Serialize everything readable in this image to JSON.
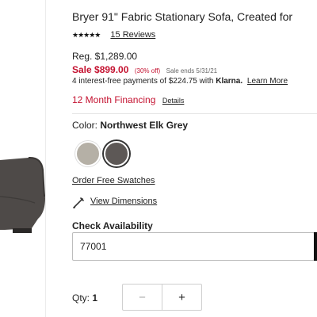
{
  "product": {
    "title": "Bryer 91\" Fabric Stationary Sofa, Created for",
    "stars": "★★★★★",
    "reviews_link": "15 Reviews"
  },
  "pricing": {
    "regular": "Reg. $1,289.00",
    "sale": "Sale $899.00",
    "discount": "(30% off)",
    "sale_end": "Sale ends 5/31/21",
    "installments_text": "4 interest-free payments of $224.75 with",
    "installments_brand": "Klarna.",
    "learn_more": "Learn More",
    "financing": "12 Month Financing",
    "financing_details": "Details"
  },
  "color": {
    "label": "Color: ",
    "value": "Northwest Elk Grey",
    "swatches": [
      {
        "name": "Light Grey",
        "hex": "#b5b0a6"
      },
      {
        "name": "Northwest Elk Grey",
        "hex": "#5d5856",
        "selected": true
      }
    ]
  },
  "links": {
    "order_swatches": "Order Free Swatches",
    "view_dimensions": "View Dimensions"
  },
  "availability": {
    "label": "Check Availability",
    "zip_value": "77001"
  },
  "quantity": {
    "label": "Qty: ",
    "value": "1",
    "minus": "−",
    "plus": "+"
  },
  "colors": {
    "sale_red": "#c41230",
    "sofa_fabric": "#4e4a48"
  },
  "icons": {
    "dimensions": "ruler-pencil-icon"
  }
}
